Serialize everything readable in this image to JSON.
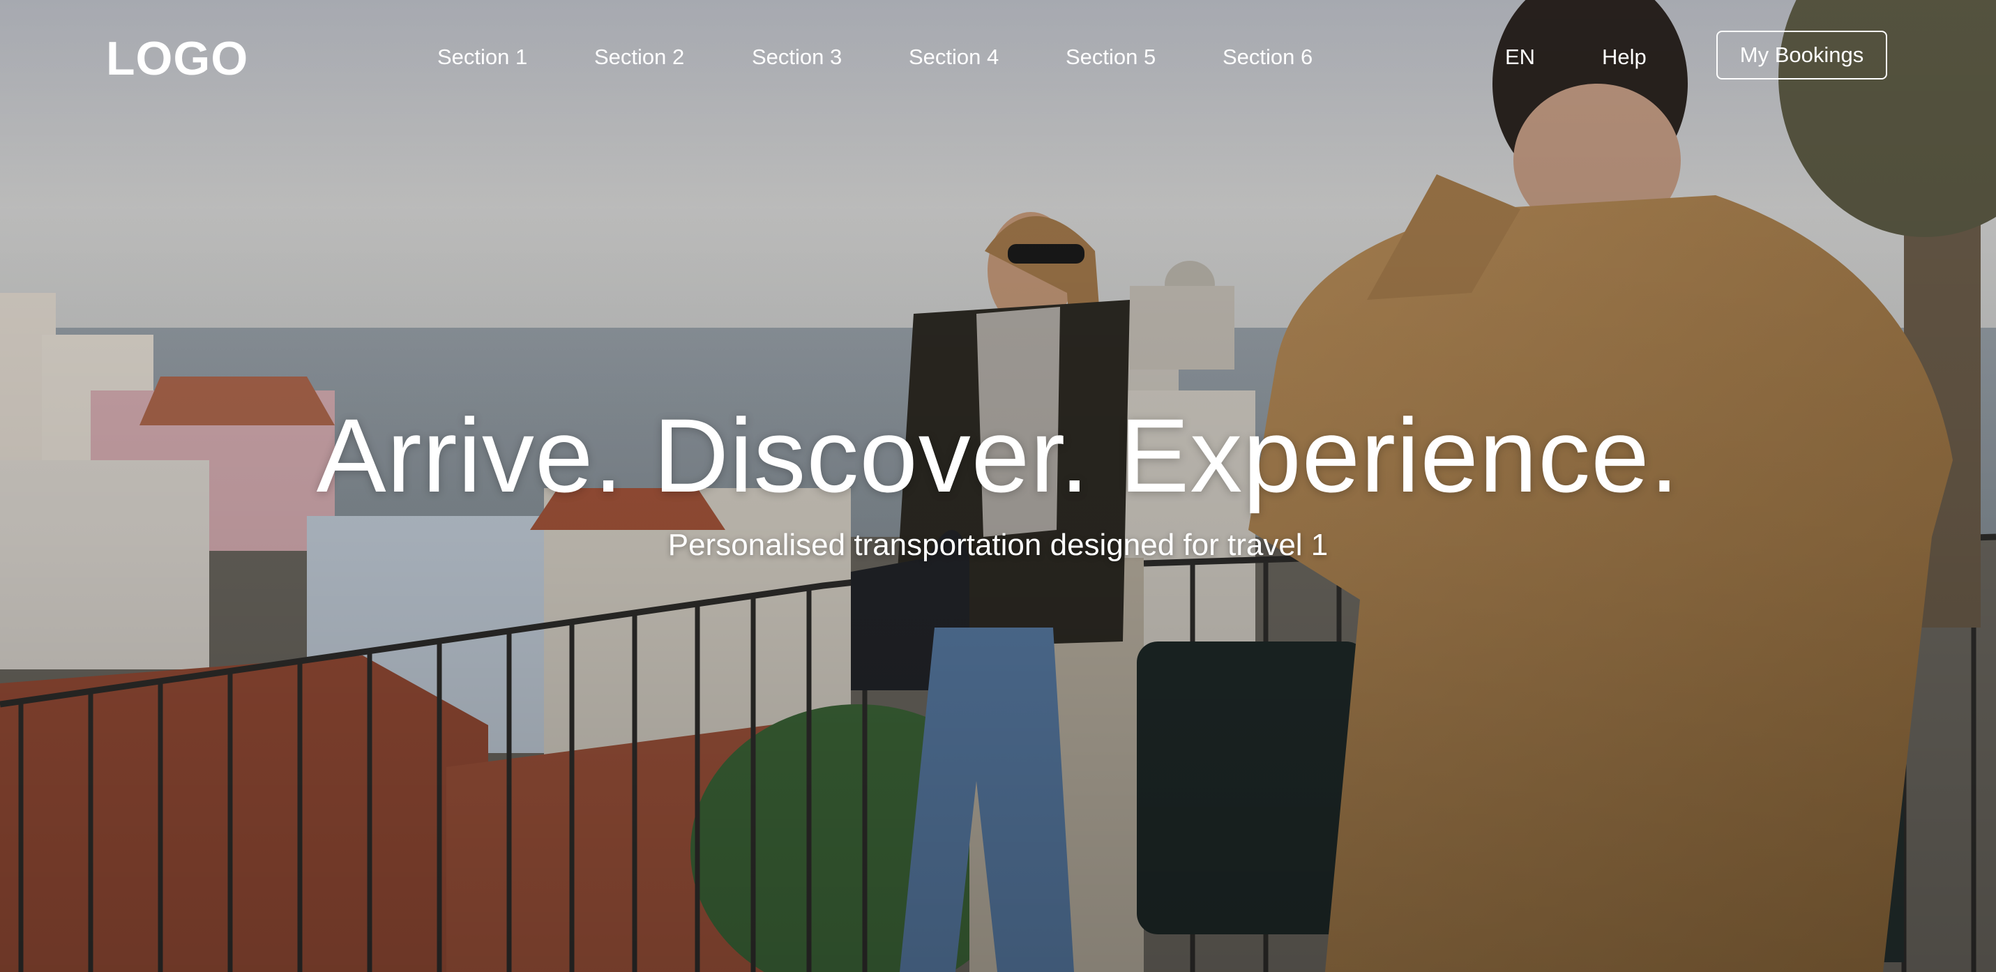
{
  "header": {
    "logo": "LOGO",
    "nav": [
      {
        "label": "Section 1"
      },
      {
        "label": "Section 2"
      },
      {
        "label": "Section 3"
      },
      {
        "label": "Section 4"
      },
      {
        "label": "Section 5"
      },
      {
        "label": "Section 6"
      }
    ],
    "language": "EN",
    "help": "Help",
    "bookings": "My Bookings"
  },
  "hero": {
    "headline": "Arrive. Discover. Experience.",
    "subheadline": "Personalised transportation designed for travel 1"
  },
  "colors": {
    "text": "#ffffff",
    "sky": "#c9ccd2",
    "roof": "#a8533a",
    "jacket": "#b08552"
  }
}
